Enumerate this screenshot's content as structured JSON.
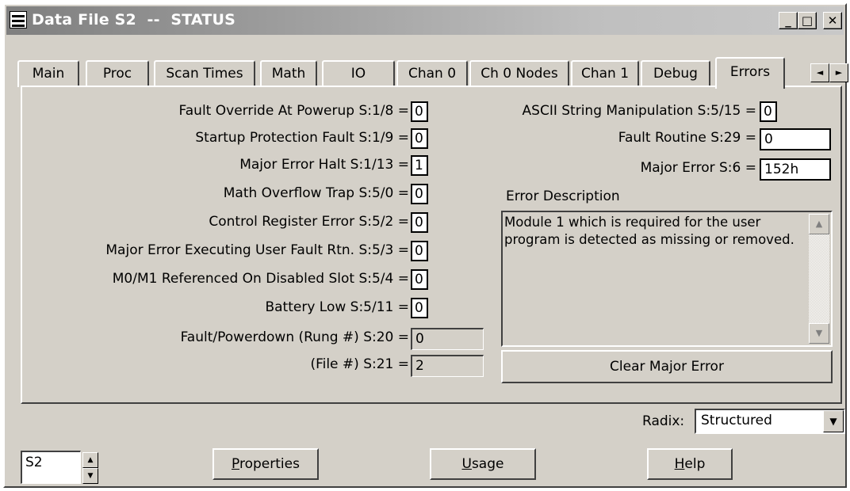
{
  "window": {
    "title": "Data File S2  --  STATUS",
    "minimize": "_",
    "maximize": "□",
    "close": "✕"
  },
  "tabs": [
    "Main",
    "Proc",
    "Scan Times",
    "Math",
    "IO",
    "Chan 0",
    "Ch 0 Nodes",
    "Chan 1",
    "Debug",
    "Errors"
  ],
  "active_tab": "Errors",
  "tab_scroll": {
    "left": "◄",
    "right": "►"
  },
  "left_fields": [
    {
      "label": "Fault Override At Powerup S:1/8 =",
      "value": "0"
    },
    {
      "label": "Startup Protection Fault S:1/9 =",
      "value": "0"
    },
    {
      "label": "Major Error Halt S:1/13 =",
      "value": "1"
    },
    {
      "label": "Math Overflow Trap S:5/0 =",
      "value": "0"
    },
    {
      "label": "Control Register Error S:5/2 =",
      "value": "0"
    },
    {
      "label": "Major Error Executing User Fault Rtn. S:5/3 =",
      "value": "0"
    },
    {
      "label": "M0/M1 Referenced On Disabled Slot S:5/4 =",
      "value": "0"
    },
    {
      "label": "Battery Low S:5/11 =",
      "value": "0"
    }
  ],
  "fault_powerdown": {
    "label": "Fault/Powerdown (Rung #) S:20 =",
    "value": "0"
  },
  "file_number": {
    "label": "(File #) S:21 =",
    "value": "2"
  },
  "ascii_manip": {
    "label": "ASCII String Manipulation S:5/15 =",
    "value": "0"
  },
  "fault_routine": {
    "label": "Fault Routine S:29 =",
    "value": "0"
  },
  "major_error": {
    "label": "Major Error S:6 =",
    "value": "152h"
  },
  "error_description": {
    "label": "Error Description",
    "text": "Module 1  which is required for the user program is detected as missing or removed."
  },
  "clear_button": "Clear Major Error",
  "radix": {
    "label": "Radix:",
    "value": "Structured"
  },
  "file_input": {
    "value": "S2"
  },
  "buttons": {
    "properties": "Properties",
    "usage": "Usage",
    "help": "Help"
  }
}
